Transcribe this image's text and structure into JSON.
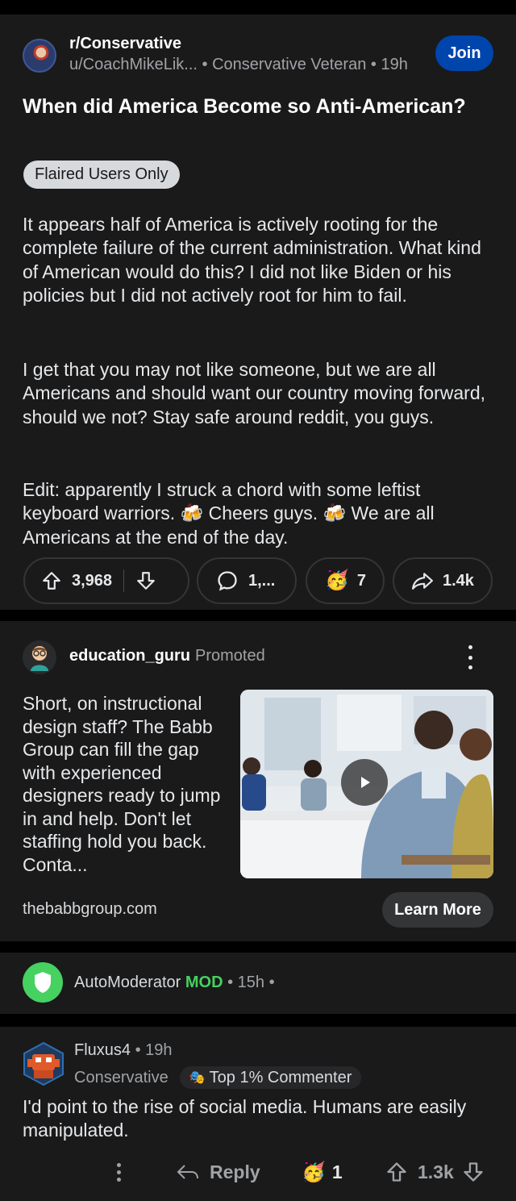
{
  "post": {
    "subreddit": "r/Conservative",
    "username": "u/CoachMikeLik...",
    "user_flair": "Conservative Veteran",
    "time": "19h",
    "join_label": "Join",
    "title": "When did America Become so Anti-American?",
    "flair": "Flaired Users Only",
    "paragraphs": [
      "It appears half of America is actively rooting for the complete failure of the current administration. What kind of American would do this? I did not like Biden or his policies but I did not actively root for him to fail.",
      "I get that you may not like someone, but we are all Americans and should want our country moving forward, should we not? Stay safe around reddit, you guys.",
      "Edit: apparently I struck a chord with some leftist keyboard warriors. 🍻 Cheers guys. 🍻 We are all Americans at the end of the day."
    ],
    "votes": "3,968",
    "comments": "1,...",
    "awards": "7",
    "shares": "1.4k"
  },
  "ad": {
    "username": "education_guru",
    "promoted_label": "Promoted",
    "text": "Short, on instructional design staff? The Babb Group can fill the gap with experienced designers ready to jump in and help. Don't let staffing hold you back. Conta...",
    "domain": "thebabbgroup.com",
    "cta": "Learn More"
  },
  "automod": {
    "username": "AutoModerator",
    "mod_tag": "MOD",
    "time": "15h",
    "trailing": "•"
  },
  "comment": {
    "username": "Fluxus4",
    "time": "19h",
    "flair": "Conservative",
    "badge": "Top 1% Commenter",
    "badge_emoji": "🎭",
    "text": "I'd point to the rise of social media.  Humans are easily manipulated.",
    "reply_label": "Reply",
    "award_count": "1",
    "votes": "1.3k"
  },
  "colors": {
    "background": "#000000",
    "card": "#1a1a1b",
    "join_button": "#0045ac",
    "mod_green": "#46d160",
    "text_muted": "#a0a3a6"
  }
}
